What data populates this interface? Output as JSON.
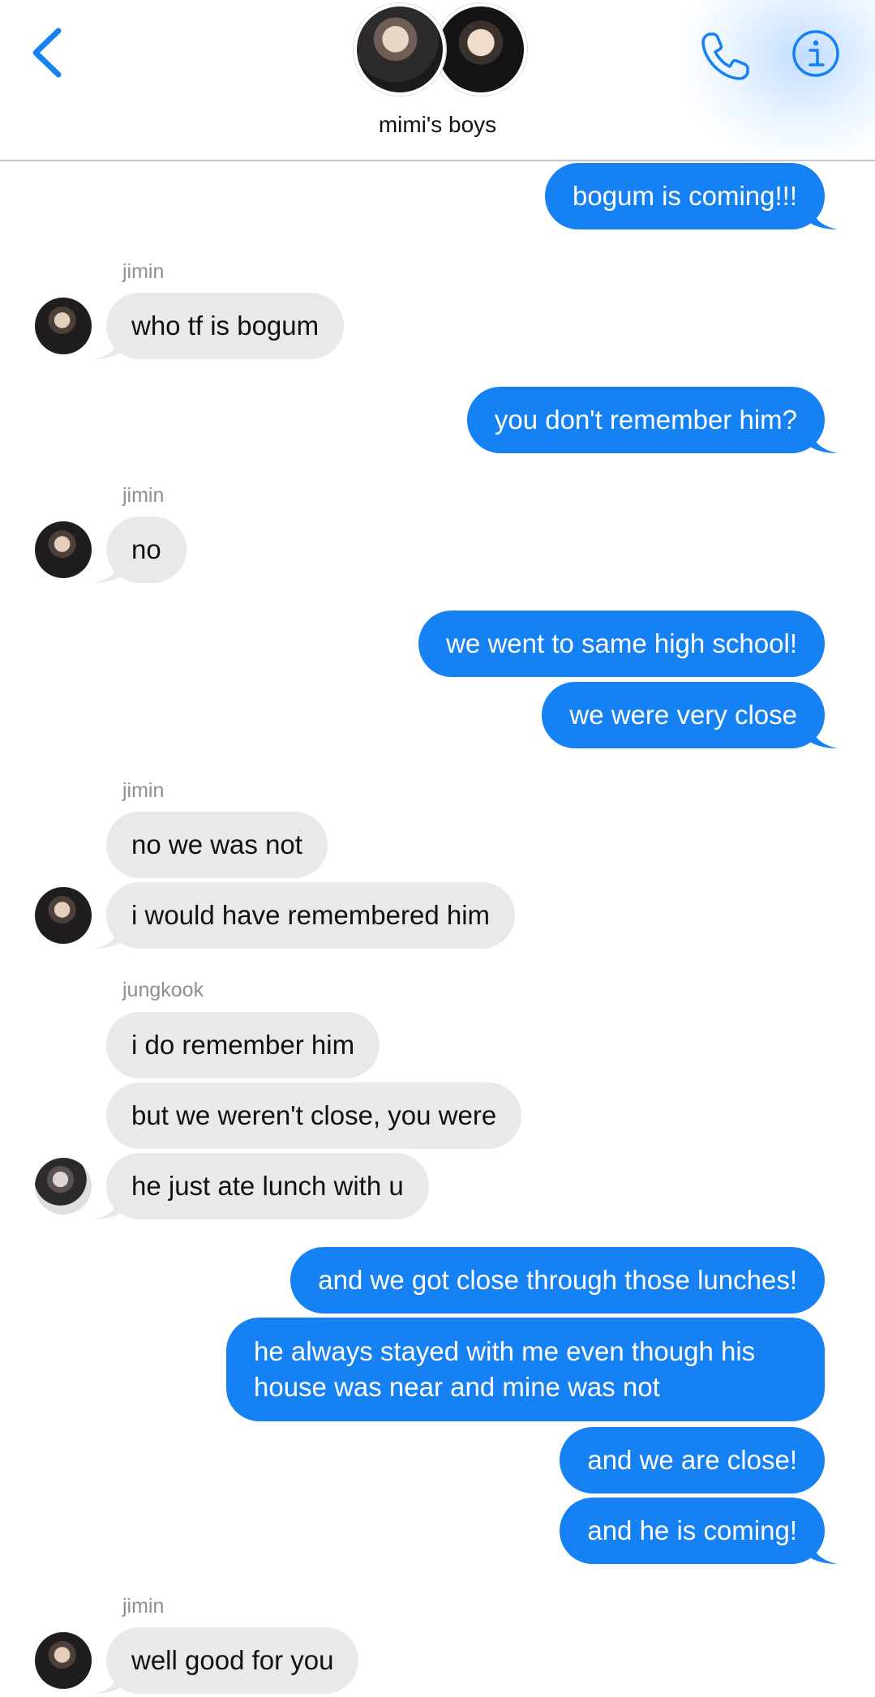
{
  "header": {
    "group_name": "mimi's boys",
    "accent_color": "#1581f2",
    "icons": [
      "chevron-left-icon",
      "phone-icon",
      "info-icon"
    ]
  },
  "messages": [
    {
      "type": "out",
      "text": "bogum is coming!!!"
    },
    {
      "sender": "jimin"
    },
    {
      "type": "in",
      "text": "who tf is bogum"
    },
    {
      "type": "out",
      "text": "you don't remember him?"
    },
    {
      "sender": "jimin"
    },
    {
      "type": "in",
      "text": "no"
    },
    {
      "type": "out",
      "text": "we went to same high school!"
    },
    {
      "type": "out",
      "text": "we were very close"
    },
    {
      "sender": "jimin"
    },
    {
      "type": "in",
      "text": "no we was not"
    },
    {
      "type": "in",
      "text": "i would have remembered him"
    },
    {
      "sender": "jungkook"
    },
    {
      "type": "in",
      "text": "i do remember him"
    },
    {
      "type": "in",
      "text": "but we weren't close, you were"
    },
    {
      "type": "in",
      "text": "he just ate lunch with u"
    },
    {
      "type": "out",
      "text": "and we got close through those lunches!"
    },
    {
      "type": "out",
      "text": "he always stayed with me even though his house was near and mine was not"
    },
    {
      "type": "out",
      "text": "and we are close!"
    },
    {
      "type": "out",
      "text": "and he is coming!"
    },
    {
      "sender": "jimin"
    },
    {
      "type": "in",
      "text": "well good for you"
    }
  ]
}
